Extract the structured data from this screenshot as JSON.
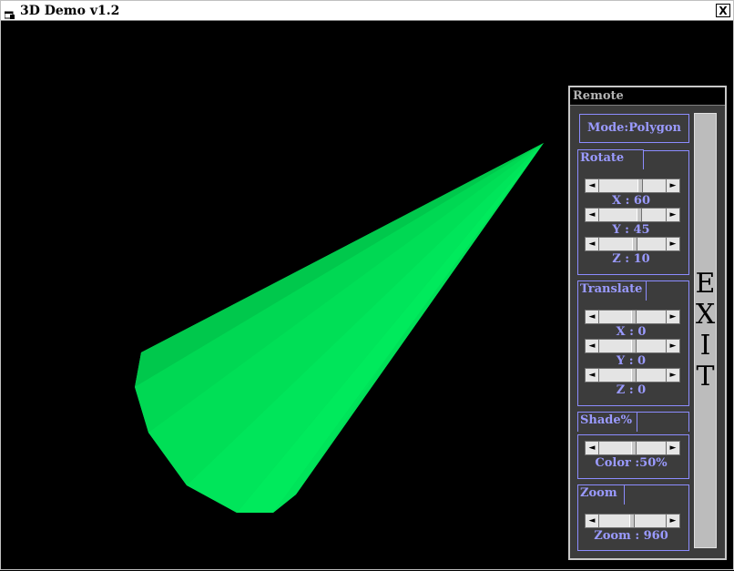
{
  "window": {
    "title": "3D Demo v1.2",
    "close_label": "X"
  },
  "scene": {
    "shape_color": "#00e85a",
    "background": "#000000"
  },
  "remote": {
    "title": "Remote",
    "mode": "Mode:Polygon",
    "exit_letters": [
      "E",
      "X",
      "I",
      "T"
    ],
    "rotate": {
      "label": "Rotate",
      "x": {
        "label": "X : 60",
        "value": 60
      },
      "y": {
        "label": "Y : 45",
        "value": 45
      },
      "z": {
        "label": "Z : 10",
        "value": 10
      }
    },
    "translate": {
      "label": "Translate",
      "x": {
        "label": "X : 0",
        "value": 0
      },
      "y": {
        "label": "Y : 0",
        "value": 0
      },
      "z": {
        "label": "Z : 0",
        "value": 0
      }
    },
    "shade": {
      "label": "Shade%",
      "value_label": "Color :50%",
      "value": 50
    },
    "zoom": {
      "label": "Zoom",
      "value_label": "Zoom : 960",
      "value": 960
    }
  }
}
